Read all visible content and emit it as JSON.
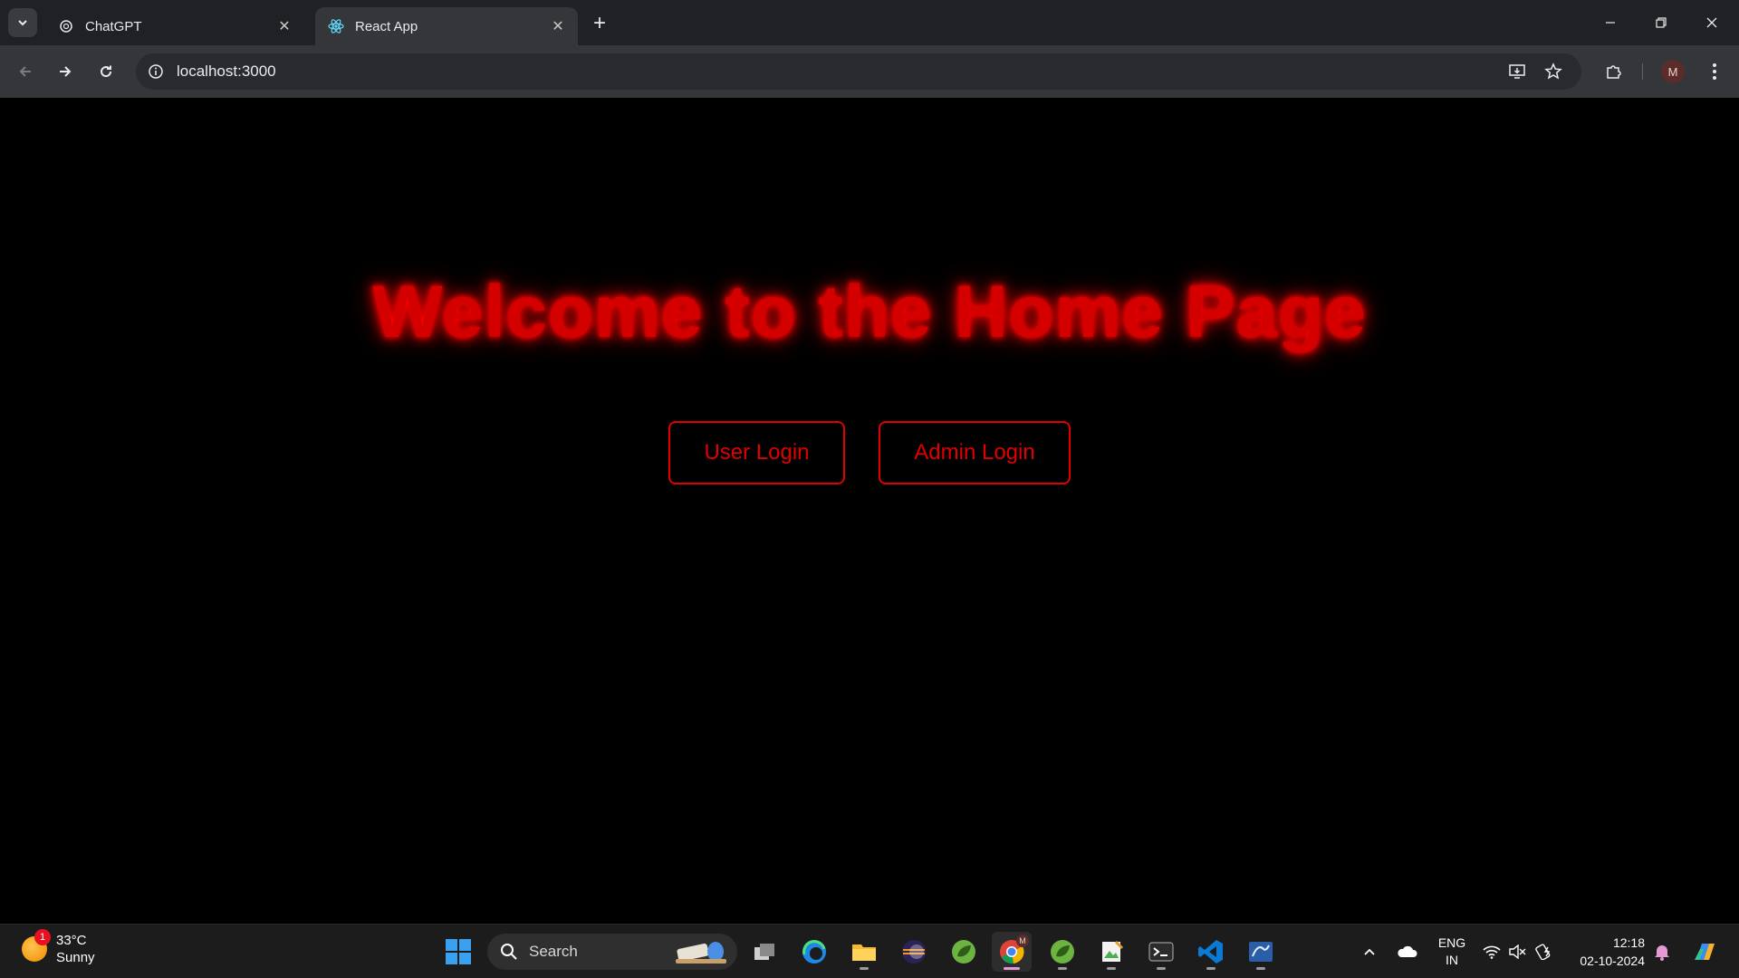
{
  "browser": {
    "tabs": [
      {
        "title": "ChatGPT",
        "icon": "chatgpt-icon",
        "active": false
      },
      {
        "title": "React App",
        "icon": "react-icon",
        "active": true
      }
    ],
    "address": "localhost:3000",
    "profile_initial": "M"
  },
  "page": {
    "headline": "Welcome to the Home Page",
    "buttons": {
      "user_login": "User Login",
      "admin_login": "Admin Login"
    },
    "colors": {
      "accent": "#e00000",
      "background": "#000000"
    }
  },
  "taskbar": {
    "weather": {
      "temp": "33°C",
      "condition": "Sunny",
      "badge": "1"
    },
    "search_label": "Search",
    "chrome_badge": "M",
    "language": {
      "line1": "ENG",
      "line2": "IN"
    },
    "clock": {
      "time": "12:18",
      "date": "02-10-2024"
    }
  }
}
